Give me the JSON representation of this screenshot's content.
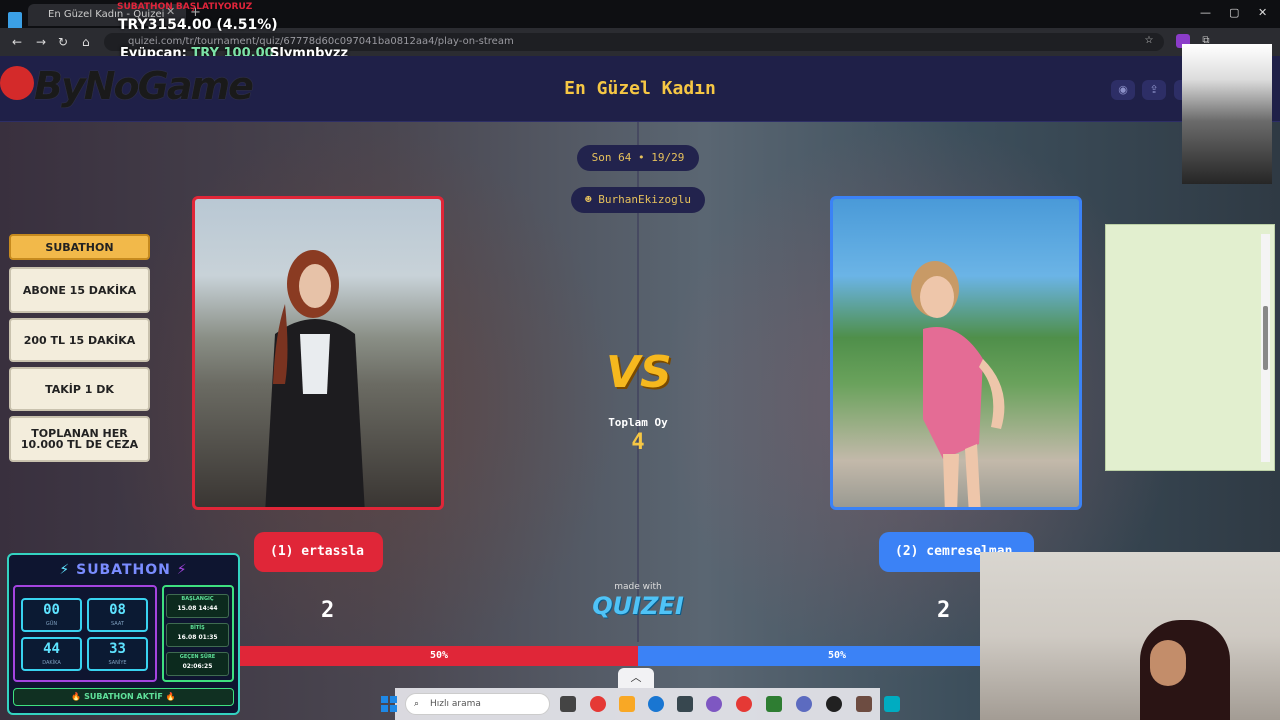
{
  "browser": {
    "tab_title": "En Güzel Kadın - Quizei",
    "url": "quizei.com/tr/tournament/quiz/67778d60c097041ba0812aa4/play-on-stream"
  },
  "stream_overlay": {
    "top_red_text": "SUBATHON BAŞLATIYORUZ",
    "donation_total": "TRY3154.00 (4.51%)",
    "last_donor_name": "Eyüpcan:",
    "last_donor_amount": "TRY 100.00",
    "last_follower": "Slymnbyzz",
    "logo_text": "ByNoGame"
  },
  "app": {
    "title": "En Güzel Kadın",
    "header_icons": [
      "eye-icon",
      "share-icon",
      "send-icon",
      "flag-icon"
    ],
    "round_label": "Son 64 • 19/29",
    "author": "BurhanEkizoglu",
    "vs_label": "VS",
    "total_votes_label": "Toplam Oy",
    "total_votes": "4",
    "made_with_label": "made with",
    "brand": "QUIZEI",
    "left": {
      "name": "(1) ertassla",
      "votes": "2",
      "percent_label": "50%",
      "percent": 50,
      "color": "#e02638"
    },
    "right": {
      "name": "(2) cemreselman",
      "votes": "2",
      "percent_label": "50%",
      "percent": 50,
      "color": "#3b82f6"
    }
  },
  "subathon_list": {
    "items": [
      "SUBATHON",
      "ABONE 15 DAKİKA",
      "200 TL 15 DAKİKA",
      "TAKİP 1 DK",
      "TOPLANAN HER 10.000 TL DE CEZA"
    ],
    "active_index": 0
  },
  "subathon_widget": {
    "title": "SUBATHON",
    "timers": [
      {
        "value": "00",
        "label": "GÜN"
      },
      {
        "value": "08",
        "label": "SAAT"
      },
      {
        "value": "44",
        "label": "DAKİKA"
      },
      {
        "value": "33",
        "label": "SANİYE"
      }
    ],
    "info": [
      {
        "label": "BAŞLANGIÇ",
        "value": "15.08 14:44"
      },
      {
        "label": "BİTİŞ",
        "value": "16.08 01:35"
      },
      {
        "label": "GEÇEN SÜRE",
        "value": "02:06:25"
      }
    ],
    "status": "SUBATHON AKTİF"
  },
  "taskbar": {
    "search_placeholder": "Hızlı arama"
  }
}
